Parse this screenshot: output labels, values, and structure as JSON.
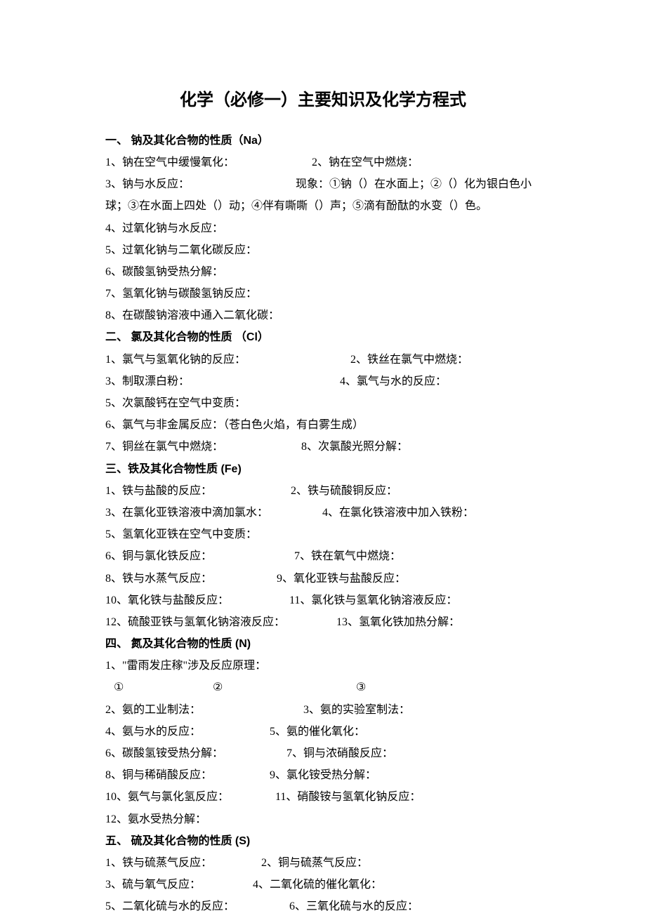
{
  "title": "化学（必修一）主要知识及化学方程式",
  "sections": {
    "s1": {
      "heading": "一、 钠及其化合物的性质（Na）",
      "l1a": "1、钠在空气中缓慢氧化：",
      "l1b": "2、钠在空气中燃烧：",
      "l2a": "3、钠与水反应：",
      "l2b": "现象：①钠（）在水面上；②（）化为银白色小",
      "l3": "球；③在水面上四处（）动；④伴有嘶嘶（）声；⑤滴有酚酞的水变（）色。",
      "l4": "4、过氧化钠与水反应：",
      "l5": "5、过氧化钠与二氧化碳反应：",
      "l6": "6、碳酸氢钠受热分解：",
      "l7": "7、氢氧化钠与碳酸氢钠反应：",
      "l8": "8、在碳酸钠溶液中通入二氧化碳："
    },
    "s2": {
      "heading": "二、 氯及其化合物的性质 （Cl）",
      "l1a": "1、氯气与氢氧化钠的反应：",
      "l1b": "2、铁丝在氯气中燃烧：",
      "l2a": "3、制取漂白粉：",
      "l2b": "4、氯气与水的反应：",
      "l3": "5、次氯酸钙在空气中变质：",
      "l4": "6、氯气与非金属反应：（苍白色火焰，有白雾生成）",
      "l5a": "7、铜丝在氯气中燃烧：",
      "l5b": "8、次氯酸光照分解："
    },
    "s3": {
      "heading": "三、铁及其化合物性质 (Fe)",
      "l1a": "1、铁与盐酸的反应：",
      "l1b": "2、铁与硫酸铜反应：",
      "l2a": "3、在氯化亚铁溶液中滴加氯水：",
      "l2b": "4、在氯化铁溶液中加入铁粉：",
      "l3": "5、氢氧化亚铁在空气中变质：",
      "l4a": "6、铜与氯化铁反应：",
      "l4b": "7、铁在氧气中燃烧：",
      "l5a": "8、铁与水蒸气反应：",
      "l5b": "9、氧化亚铁与盐酸反应：",
      "l6a": "10、氧化铁与盐酸反应：",
      "l6b": "11、氯化铁与氢氧化钠溶液反应：",
      "l7a": "12、硫酸亚铁与氢氧化钠溶液反应：",
      "l7b": "13、氢氧化铁加热分解："
    },
    "s4": {
      "heading": "四、 氮及其化合物的性质 (N)",
      "l1": "1、\"雷雨发庄稼\"涉及反应原理：",
      "l2a": "①",
      "l2b": "②",
      "l2c": "③",
      "l3a": "2、氨的工业制法：",
      "l3b": "3、氨的实验室制法：",
      "l4a": "4、氨与水的反应：",
      "l4b": "5、氨的催化氧化：",
      "l5a": "6、碳酸氢铵受热分解：",
      "l5b": "7、铜与浓硝酸反应：",
      "l6a": "8、铜与稀硝酸反应：",
      "l6b": "9、氯化铵受热分解：",
      "l7a": "10、氨气与氯化氢反应：",
      "l7b": "11、硝酸铵与氢氧化钠反应：",
      "l8": "12、氨水受热分解："
    },
    "s5": {
      "heading": "五、 硫及其化合物的性质 (S)",
      "l1a": "1、铁与硫蒸气反应：",
      "l1b": "2、铜与硫蒸气反应：",
      "l2a": "3、硫与氧气反应：",
      "l2b": "4、二氧化硫的催化氧化：",
      "l3a": "5、二氧化硫与水的反应：",
      "l3b": "6、三氧化硫与水的反应："
    }
  }
}
